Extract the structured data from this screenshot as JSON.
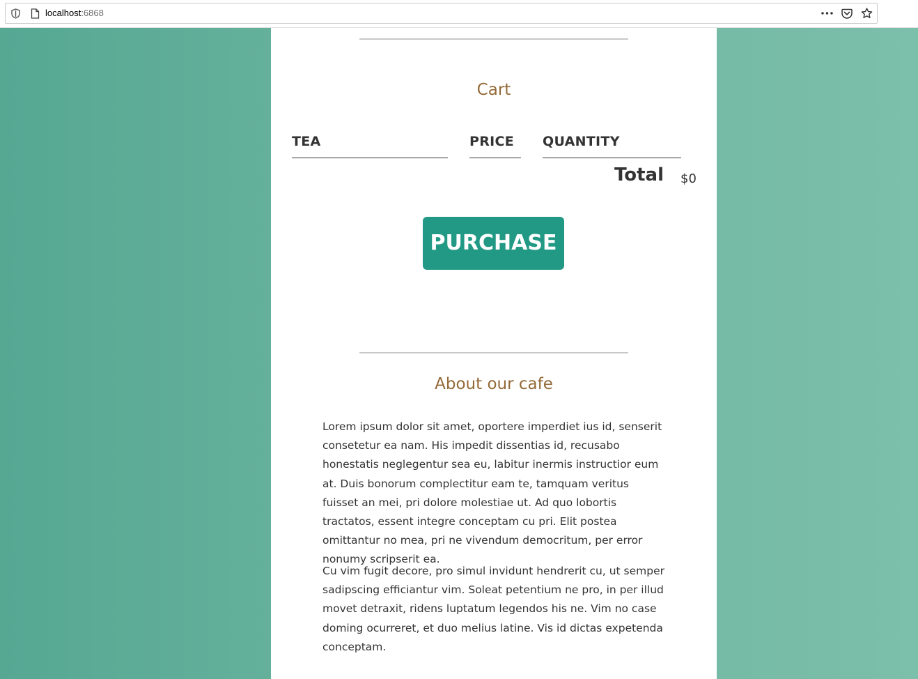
{
  "browser": {
    "url_host": "localhost",
    "url_port": ":6868"
  },
  "cart": {
    "title": "Cart",
    "columns": [
      "TEA",
      "PRICE",
      "QUANTITY"
    ],
    "total_label": "Total",
    "total_value": "$0",
    "purchase_label": "PURCHASE"
  },
  "about": {
    "title": "About our cafe",
    "paragraphs": [
      "Lorem ipsum dolor sit amet, oportere imperdiet ius id, senserit consetetur ea nam. His impedit dissentias id, recusabo honestatis neglegentur sea eu, labitur inermis instructior eum at. Duis bonorum complectitur eam te, tamquam veritus fuisset an mei, pri dolore molestiae ut. Ad quo lobortis tractatos, essent integre conceptam cu pri. Elit postea omittantur no mea, pri ne vivendum democritum, per error nonumy scripserit ea.",
      "Cu vim fugit decore, pro simul invidunt hendrerit cu, ut semper sadipscing efficiantur vim. Soleat petentium ne pro, in per illud movet detraxit, ridens luptatum legendos his ne. Vim no case doming ocurreret, et duo melius latine. Vis id dictas expetenda conceptam."
    ]
  },
  "colors": {
    "accent_button": "#229984",
    "heading": "#946a38",
    "background_left": "#56a893",
    "background_right": "#7cbfab"
  }
}
